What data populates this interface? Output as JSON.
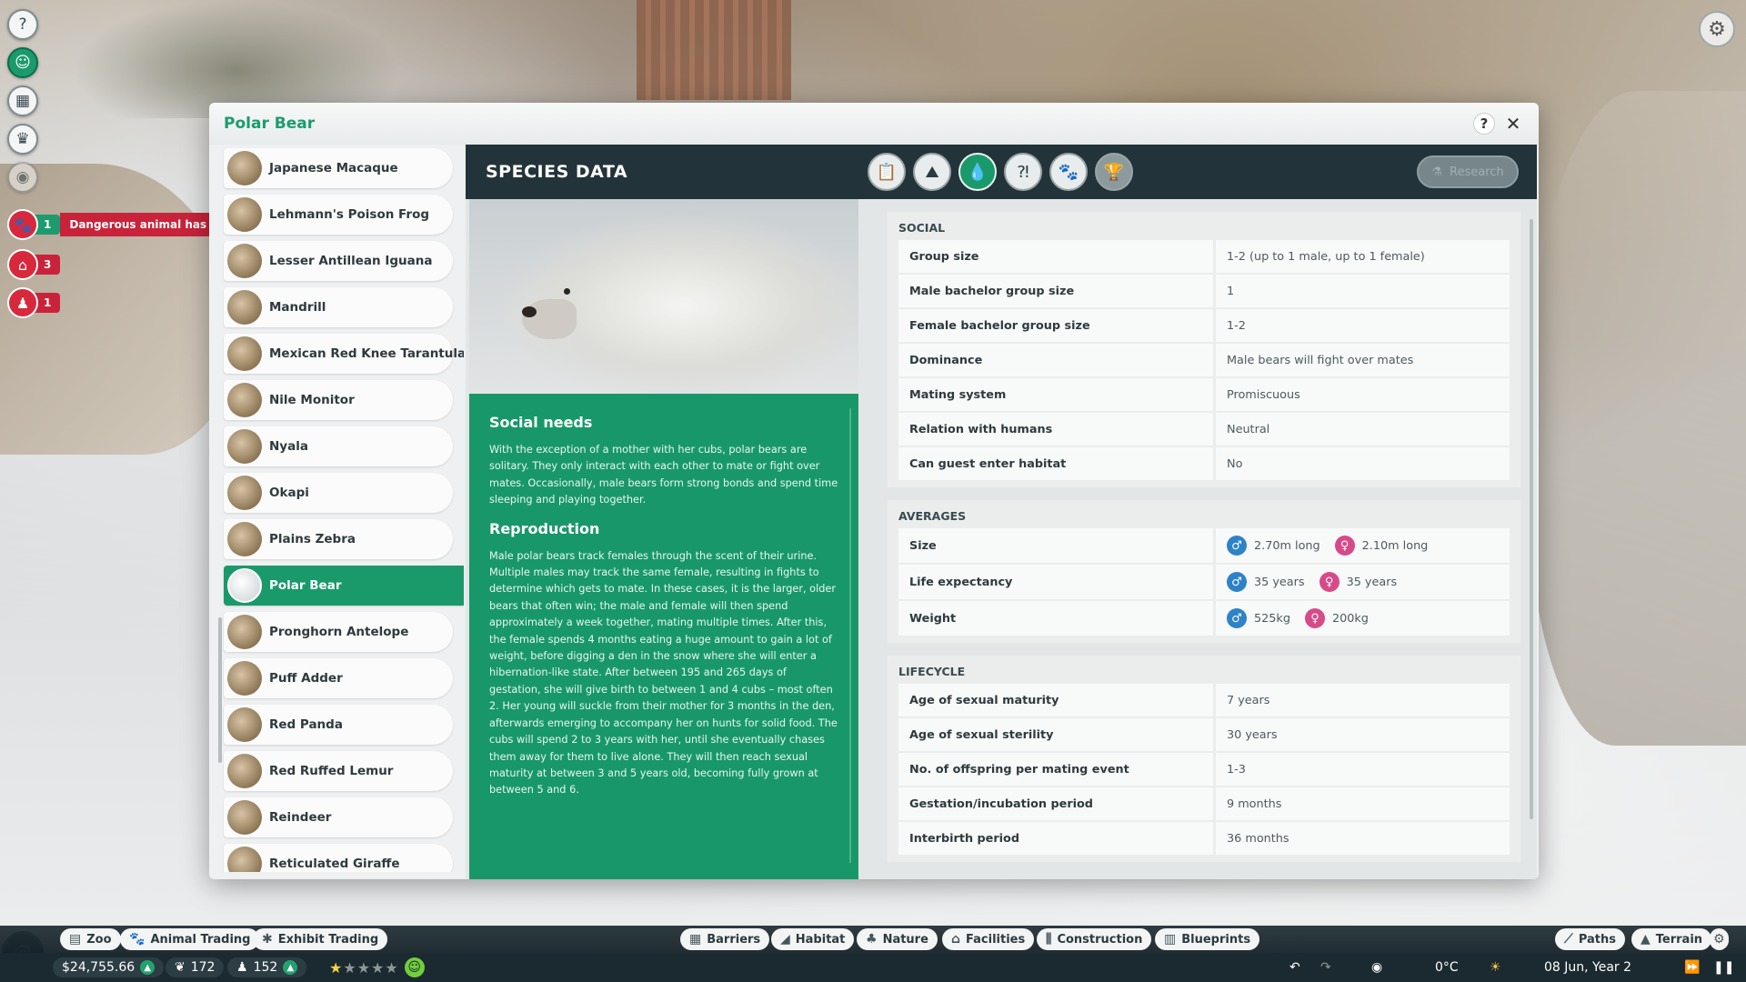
{
  "window": {
    "title": "Polar Bear",
    "help_label": "?",
    "close_label": "✕"
  },
  "side_icons": [
    "?",
    "☺",
    "▦",
    "♛",
    "◉"
  ],
  "alerts": {
    "escape": {
      "count": "1",
      "text": "Dangerous animal has escaped!"
    },
    "staff": {
      "count": "3"
    },
    "guests": {
      "count": "1"
    }
  },
  "species_list": [
    {
      "name": "Japanese Macaque",
      "selected": false
    },
    {
      "name": "Lehmann's Poison Frog",
      "selected": false
    },
    {
      "name": "Lesser Antillean Iguana",
      "selected": false
    },
    {
      "name": "Mandrill",
      "selected": false
    },
    {
      "name": "Mexican Red Knee Tarantula",
      "selected": false
    },
    {
      "name": "Nile Monitor",
      "selected": false
    },
    {
      "name": "Nyala",
      "selected": false
    },
    {
      "name": "Okapi",
      "selected": false
    },
    {
      "name": "Plains Zebra",
      "selected": false
    },
    {
      "name": "Polar Bear",
      "selected": true
    },
    {
      "name": "Pronghorn Antelope",
      "selected": false
    },
    {
      "name": "Puff Adder",
      "selected": false
    },
    {
      "name": "Red Panda",
      "selected": false
    },
    {
      "name": "Red Ruffed Lemur",
      "selected": false
    },
    {
      "name": "Reindeer",
      "selected": false
    },
    {
      "name": "Reticulated Giraffe",
      "selected": false
    }
  ],
  "detail": {
    "title": "SPECIES DATA",
    "tabs": [
      {
        "name": "tab-info",
        "icon": "📋",
        "state": "normal"
      },
      {
        "name": "tab-habitat",
        "icon": "⛰",
        "state": "normal"
      },
      {
        "name": "tab-species-data",
        "icon": "💧",
        "state": "active"
      },
      {
        "name": "tab-enrichment",
        "icon": "⁈",
        "state": "normal"
      },
      {
        "name": "tab-paw",
        "icon": "🐾",
        "state": "normal"
      },
      {
        "name": "tab-trophy",
        "icon": "🏆",
        "state": "disabled"
      }
    ],
    "research_label": "Research",
    "social_needs_title": "Social needs",
    "social_needs_text": "With the exception of a mother with her cubs, polar bears are solitary. They only interact with each other to mate or fight over mates. Occasionally, male bears form strong bonds and spend time sleeping and playing together.",
    "reproduction_title": "Reproduction",
    "reproduction_text": "Male polar bears track females through the scent of their urine. Multiple males may track the same female, resulting in fights to determine which gets to mate. In these cases, it is the larger, older bears that often win; the male and female will then spend approximately a week together, mating multiple times. After this, the female spends 4 months eating a huge amount to gain a lot of weight, before digging a den in the snow where she will enter a hibernation-like state. After between 195 and 265 days of gestation, she will give birth to between 1 and 4 cubs – most often 2. Her young will suckle from their mother for 3 months in the den, afterwards emerging to accompany her on hunts for solid food. The cubs will spend 2 to 3 years with her, until she eventually chases them away for them to live alone. They will then reach sexual maturity at between 3 and 5 years old, becoming fully grown at between 5 and 6."
  },
  "social": {
    "title": "SOCIAL",
    "rows": [
      {
        "k": "Group size",
        "v": "1-2 (up to 1 male, up to 1 female)"
      },
      {
        "k": "Male bachelor group size",
        "v": "1"
      },
      {
        "k": "Female bachelor group size",
        "v": "1-2"
      },
      {
        "k": "Dominance",
        "v": "Male bears will fight over mates"
      },
      {
        "k": "Mating system",
        "v": "Promiscuous"
      },
      {
        "k": "Relation with humans",
        "v": "Neutral"
      },
      {
        "k": "Can guest enter habitat",
        "v": "No"
      }
    ]
  },
  "averages": {
    "title": "AVERAGES",
    "rows": [
      {
        "k": "Size",
        "male": "2.70m long",
        "female": "2.10m long"
      },
      {
        "k": "Life expectancy",
        "male": "35 years",
        "female": "35 years"
      },
      {
        "k": "Weight",
        "male": "525kg",
        "female": "200kg"
      }
    ]
  },
  "lifecycle": {
    "title": "LIFECYCLE",
    "rows": [
      {
        "k": "Age of sexual maturity",
        "v": "7 years"
      },
      {
        "k": "Age of sexual sterility",
        "v": "30 years"
      },
      {
        "k": "No. of offspring per mating event",
        "v": "1-3"
      },
      {
        "k": "Gestation/incubation period",
        "v": "9 months"
      },
      {
        "k": "Interbirth period",
        "v": "36 months"
      }
    ]
  },
  "toolbar": {
    "zoo": "Zoo",
    "animal_trading": "Animal Trading",
    "exhibit_trading": "Exhibit Trading",
    "barriers": "Barriers",
    "habitat": "Habitat",
    "nature": "Nature",
    "facilities": "Facilities",
    "construction": "Construction",
    "blueprints": "Blueprints",
    "paths": "Paths",
    "terrain": "Terrain"
  },
  "status": {
    "money": "$24,755.66",
    "conservation": "172",
    "guests": "152",
    "rating_stars": 1,
    "temperature": "0°C",
    "date": "08 Jun, Year 2"
  }
}
